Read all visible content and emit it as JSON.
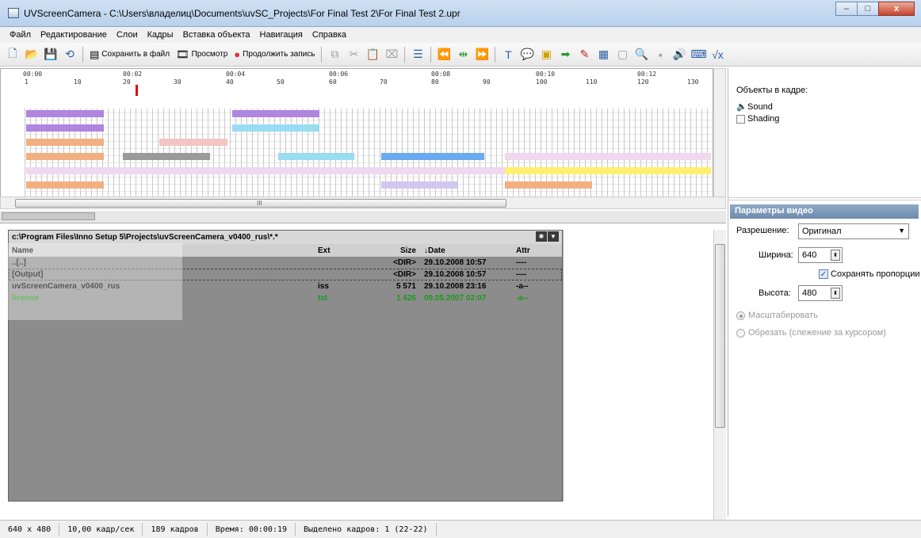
{
  "window": {
    "title": "UVScreenCamera - C:\\Users\\владелиц\\Documents\\uvSC_Projects\\For Final Test 2\\For Final Test 2.upr",
    "min": "–",
    "max": "□",
    "close": "x"
  },
  "menu": [
    "Файл",
    "Редактирование",
    "Слои",
    "Кадры",
    "Вставка объекта",
    "Навигация",
    "Справка"
  ],
  "toolbar": {
    "save_to_file": "Сохранить в файл",
    "preview": "Просмотр",
    "continue_record": "Продолжить запись"
  },
  "timeline": {
    "ruler_times": [
      "00:00",
      "00:02",
      "00:04",
      "00:06",
      "00:08",
      "00:10",
      "00:12"
    ],
    "ruler_frames": [
      "1",
      "10",
      "20",
      "30",
      "40",
      "50",
      "60",
      "70",
      "80",
      "90",
      "100",
      "110",
      "120",
      "130"
    ],
    "scroll_mark": "III"
  },
  "file_manager": {
    "path": "c:\\Program Files\\Inno Setup 5\\Projects\\uvScreenCamera_v0400_rus\\*.*",
    "headers": {
      "name": "Name",
      "ext": "Ext",
      "size": "Size",
      "date": "↓Date",
      "attr": "Attr"
    },
    "rows": [
      {
        "name": "..[..]",
        "ext": "",
        "size": "<DIR>",
        "date": "29.10.2008 10:57",
        "attr": "----"
      },
      {
        "name": "[Output]",
        "ext": "",
        "size": "<DIR>",
        "date": "29.10.2008 10:57",
        "attr": "----"
      },
      {
        "name": "uvScreenCamera_v0400_rus",
        "ext": "iss",
        "size": "5 571",
        "date": "29.10.2008 23:16",
        "attr": "-a--"
      },
      {
        "name": "license",
        "ext": "txt",
        "size": "1 426",
        "date": "09.05.2007 02:07",
        "attr": "-a--"
      }
    ]
  },
  "objects_panel": {
    "title": "Объекты в кадре:",
    "items": [
      "Sound",
      "Shading"
    ]
  },
  "video_params": {
    "header": "Параметры видео",
    "resolution_label": "Разрешение:",
    "resolution_value": "Оригинал",
    "width_label": "Ширина:",
    "width_value": "640",
    "keep_ratio_label": "Сохранять пропорции",
    "height_label": "Высота:",
    "height_value": "480",
    "scale_label": "Масштабировать",
    "crop_label": "Обрезать (слежение за курсором)"
  },
  "status": {
    "resolution": "640 x 480",
    "fps": "10,00 кадр/сек",
    "frames": "189 кадров",
    "time": "Время: 00:00:19",
    "selected": "Выделено кадров: 1 (22-22)"
  }
}
